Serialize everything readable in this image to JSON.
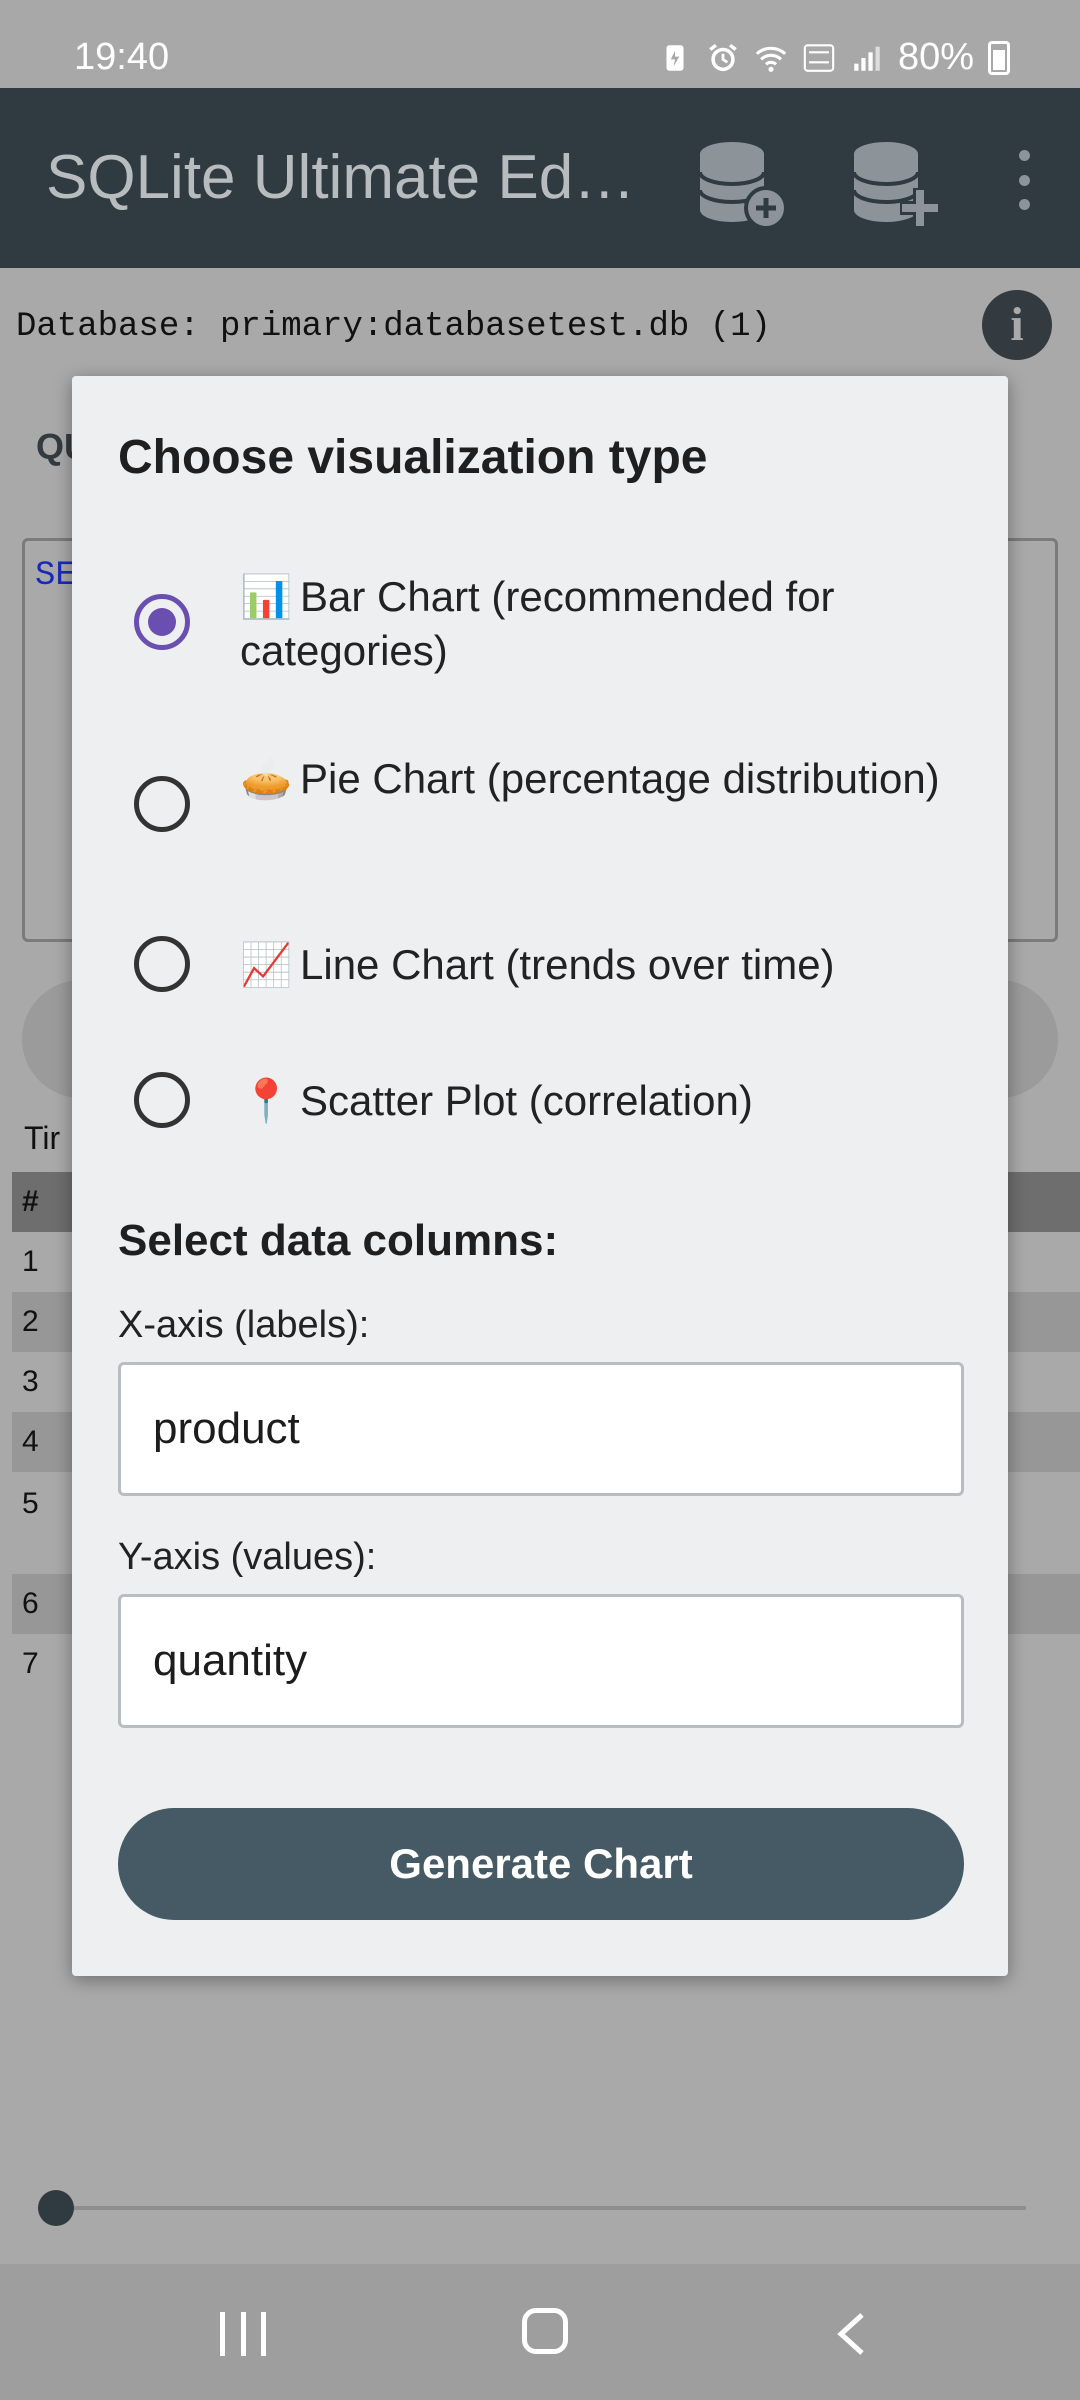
{
  "status_bar": {
    "time": "19:40",
    "battery": "80%"
  },
  "app_bar": {
    "title": "SQLite Ultimate Edit..."
  },
  "background": {
    "database_label": "Database: primary:databasetest.db (1)",
    "query_fragment": "QU",
    "editor_fragment": "SE",
    "time_fragment": "Tir",
    "table_header": "#",
    "row_numbers": [
      "1",
      "2",
      "3",
      "4",
      "5",
      "6",
      "7"
    ]
  },
  "dialog": {
    "title": "Choose visualization type",
    "options": [
      {
        "emoji": "📊",
        "label": "Bar Chart (recommended for categories)",
        "checked": true
      },
      {
        "emoji": "🥧",
        "label": "Pie Chart (percentage distribution)",
        "checked": false
      },
      {
        "emoji": "📈",
        "label": "Line Chart (trends over time)",
        "checked": false
      },
      {
        "emoji": "📍",
        "label": "Scatter Plot (correlation)",
        "checked": false
      }
    ],
    "columns_title": "Select data columns:",
    "x_axis": {
      "label": "X-axis (labels):",
      "value": "product"
    },
    "y_axis": {
      "label": "Y-axis (values):",
      "value": "quantity"
    },
    "generate_button": "Generate Chart"
  },
  "colors": {
    "appbar": "#2f3a41",
    "accent": "#6b4fb0",
    "button": "#455a64"
  }
}
